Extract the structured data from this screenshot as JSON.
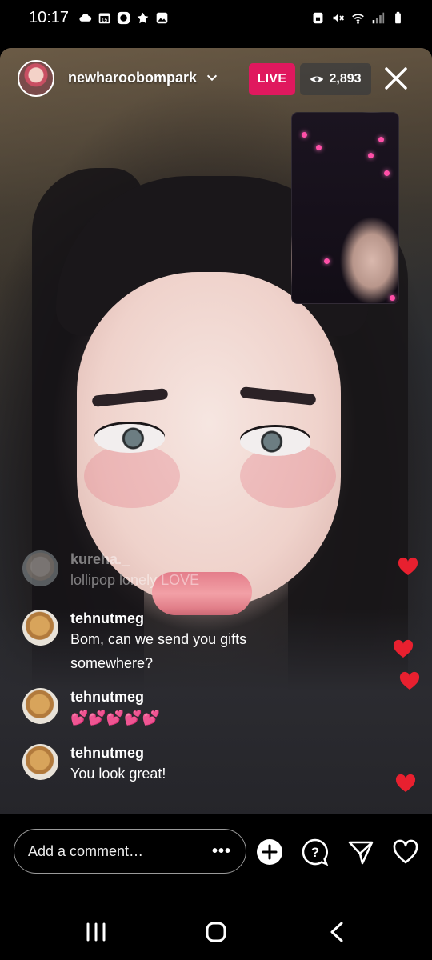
{
  "status_bar": {
    "time": "10:17",
    "left_icons": [
      "cloud-icon",
      "calendar-15-icon",
      "chat-app-icon",
      "leaf-icon",
      "gallery-icon"
    ],
    "right_icons": [
      "lock-icon",
      "mute-icon",
      "wifi-icon",
      "signal-icon",
      "battery-icon"
    ]
  },
  "live": {
    "host_name": "newharoobompark",
    "live_label": "LIVE",
    "viewer_count": "2,893",
    "accent_color": "#e0185e"
  },
  "comments": [
    {
      "user": "kureha._",
      "message": "lollipop lonely LOVE",
      "avatar": "kureha-avatar",
      "faded": true
    },
    {
      "user": "tehnutmeg",
      "message": "Bom, can we send you gifts somewhere?",
      "avatar": "dog-avatar",
      "faded": false
    },
    {
      "user": "tehnutmeg",
      "message": "💕💕💕💕💕",
      "avatar": "dog-avatar",
      "faded": false
    },
    {
      "user": "tehnutmeg",
      "message": "You look great!",
      "avatar": "dog-avatar",
      "faded": false
    }
  ],
  "bottom_bar": {
    "comment_placeholder": "Add a comment…",
    "more_label": "•••",
    "icons": [
      "add-icon",
      "question-icon",
      "send-icon",
      "like-heart-icon"
    ]
  },
  "nav_bar": {
    "icons": [
      "recents-icon",
      "home-icon",
      "back-icon"
    ]
  }
}
